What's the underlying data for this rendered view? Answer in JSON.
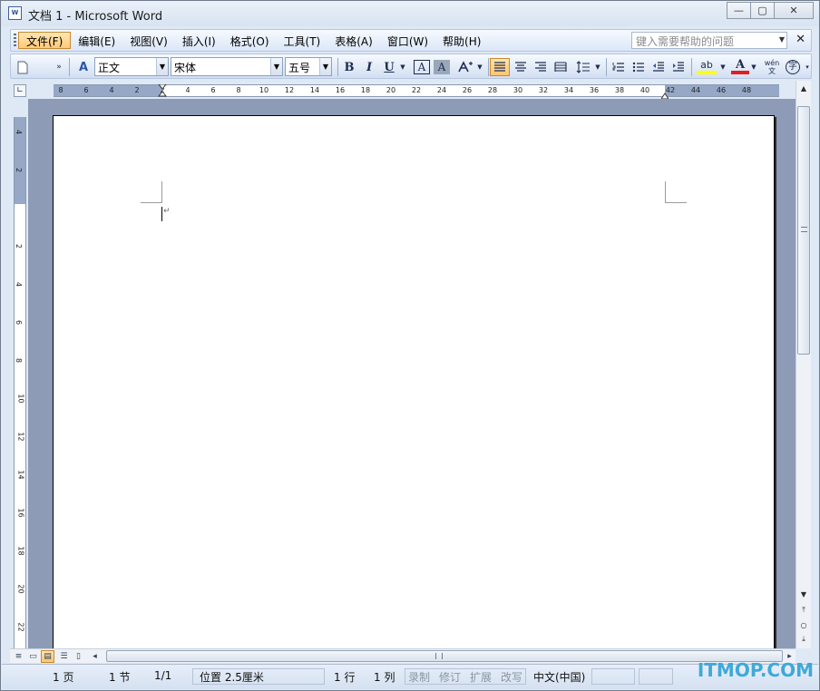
{
  "window": {
    "title": "文档 1 - Microsoft Word",
    "icon_label": "W",
    "minimize_glyph": "—",
    "maximize_glyph": "▢",
    "close_glyph": "✕"
  },
  "menubar": {
    "items": [
      "文件(F)",
      "编辑(E)",
      "视图(V)",
      "插入(I)",
      "格式(O)",
      "工具(T)",
      "表格(A)",
      "窗口(W)",
      "帮助(H)"
    ],
    "help_placeholder": "键入需要帮助的问题",
    "close_glyph": "✕"
  },
  "toolbar": {
    "style_value": "正文",
    "font_value": "宋体",
    "size_value": "五号",
    "style_icon": "A",
    "bold": "B",
    "italic": "I",
    "underline": "U",
    "char_border": "A",
    "char_shading": "A",
    "highlight": "ab",
    "font_color": "A",
    "phonetic": "wén 文",
    "enclose": "字"
  },
  "ruler": {
    "h_numbers": [
      "8",
      "6",
      "4",
      "2",
      "2",
      "4",
      "6",
      "8",
      "10",
      "12",
      "14",
      "16",
      "18",
      "20",
      "22",
      "24",
      "26",
      "28",
      "30",
      "32",
      "34",
      "36",
      "38",
      "40",
      "42",
      "44",
      "46",
      "48"
    ],
    "v_numbers": [
      "4",
      "2",
      "2",
      "4",
      "6",
      "8",
      "10",
      "12",
      "14",
      "16",
      "18",
      "20",
      "22"
    ]
  },
  "statusbar": {
    "page": "1 页",
    "section": "1 节",
    "page_of": "1/1",
    "position": "位置 2.5厘米",
    "line": "1 行",
    "column": "1 列",
    "record": "录制",
    "revise": "修订",
    "extend": "扩展",
    "overwrite": "改写",
    "language": "中文(中国)"
  },
  "watermark": "ITMOP.COM",
  "colors": {
    "menu_active": "#ffc978",
    "ruler_margin": "#96a8c6",
    "canvas_bg": "#8e9bb6",
    "watermark": "#3fa9d8"
  }
}
